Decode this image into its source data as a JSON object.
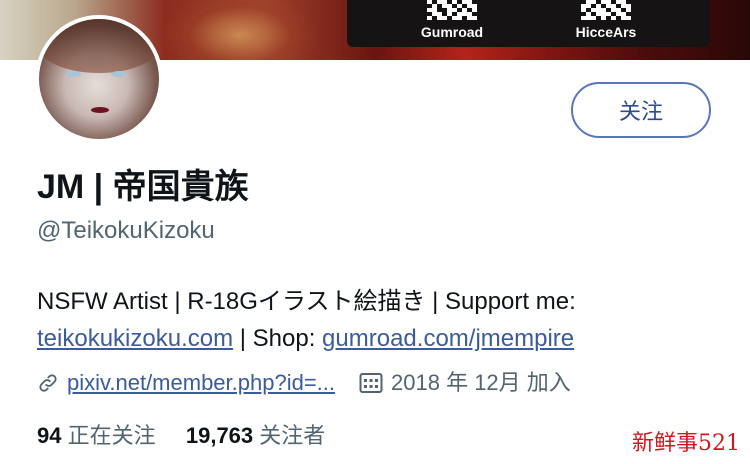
{
  "banner": {
    "qr_codes": [
      {
        "label": "Gumroad"
      },
      {
        "label": "HicceArs"
      }
    ]
  },
  "profile": {
    "avatar_icon": "avatar-portrait",
    "follow_label": "关注",
    "name": "JM | 帝国貴族",
    "handle": "@TeikokuKizoku",
    "bio": {
      "line1": "NSFW Artist | R-18Gイラスト絵描き | Support me:",
      "site_link": "teikokukizoku.com",
      "shop_sep": " | Shop: ",
      "shop_link": "gumroad.com/jmempire"
    },
    "meta": {
      "link_icon": "link-icon",
      "link_text": "pixiv.net/member.php?id=...",
      "calendar_icon": "calendar-icon",
      "joined": "2018 年 12月 加入"
    },
    "stats": {
      "following_count": "94",
      "following_label": " 正在关注",
      "followers_count": "19,763",
      "followers_label": " 关注者"
    }
  },
  "watermark": "新鲜事521",
  "colors": {
    "accent_border": "#5a76b8",
    "link": "#3b5b9a",
    "secondary_text": "#536471",
    "watermark": "#d2161f"
  }
}
